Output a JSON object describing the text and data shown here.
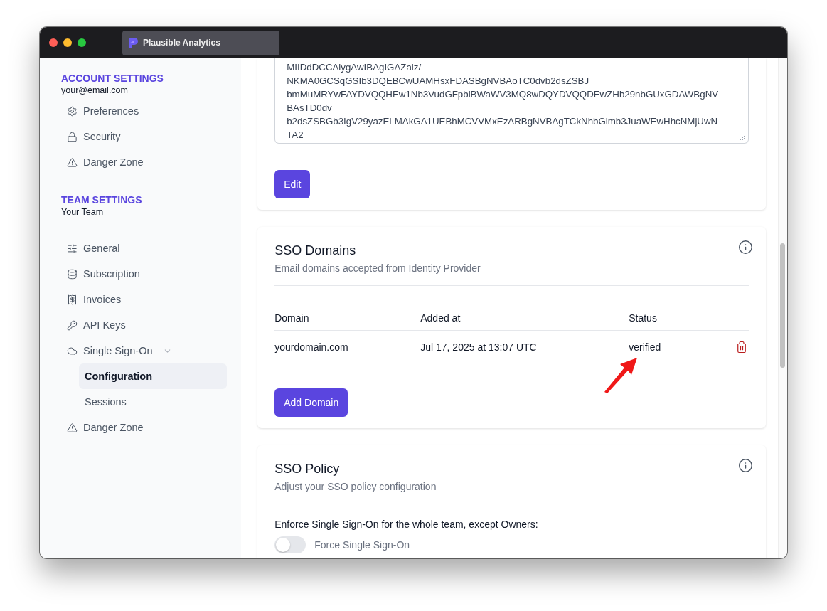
{
  "window": {
    "tab_title": "Plausible Analytics"
  },
  "sidebar": {
    "sections": [
      {
        "title": "ACCOUNT SETTINGS",
        "subtitle": "your@email.com",
        "items": [
          {
            "label": "Preferences",
            "selected": false
          },
          {
            "label": "Security",
            "selected": false
          },
          {
            "label": "Danger Zone",
            "selected": false
          }
        ]
      },
      {
        "title": "TEAM SETTINGS",
        "subtitle": "Your Team",
        "items": [
          {
            "label": "General",
            "selected": false
          },
          {
            "label": "Subscription",
            "selected": false
          },
          {
            "label": "Invoices",
            "selected": false
          },
          {
            "label": "API Keys",
            "selected": false
          },
          {
            "label": "Single Sign-On",
            "selected": false,
            "expanded": true,
            "children": [
              {
                "label": "Configuration",
                "selected": true
              },
              {
                "label": "Sessions",
                "selected": false
              }
            ]
          },
          {
            "label": "Danger Zone",
            "selected": false
          }
        ]
      }
    ]
  },
  "certificate_card": {
    "lines": [
      "MIIDdDCCAlygAwIBAgIGAZalz/",
      "NKMA0GCSqGSIb3DQEBCwUAMHsxFDASBgNVBAoTC0dvb2dsZSBJ",
      "bmMuMRYwFAYDVQQHEw1Nb3VudGFpbiBWaWV3MQ8wDQYDVQQDEwZHb29nbGUxGDAWBgNV",
      "BAsTD0dv",
      "b2dsZSBGb3IgV29yazELMAkGA1UEBhMCVVMxEzARBgNVBAgTCkNhbGlmb3JuaWEwHhcNMjUwN",
      "TA2"
    ],
    "button": "Edit"
  },
  "domains_card": {
    "title": "SSO Domains",
    "subtitle": "Email domains accepted from Identity Provider",
    "columns": [
      "Domain",
      "Added at",
      "Status"
    ],
    "rows": [
      {
        "domain": "yourdomain.com",
        "added_at": "Jul 17, 2025 at 13:07 UTC",
        "status": "verified"
      }
    ],
    "button": "Add Domain"
  },
  "policy_card": {
    "title": "SSO Policy",
    "subtitle": "Adjust your SSO policy configuration",
    "label": "Enforce Single Sign-On for the whole team, except Owners:",
    "toggle": {
      "label": "Force Single Sign-On",
      "on": false
    }
  }
}
